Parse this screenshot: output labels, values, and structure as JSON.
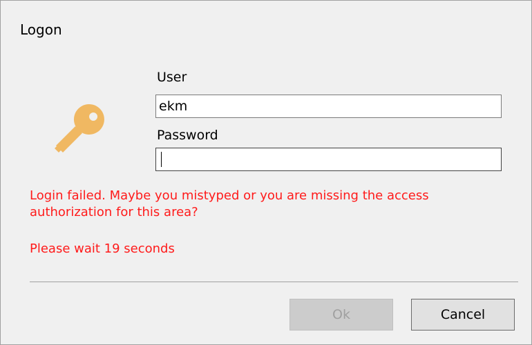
{
  "window": {
    "title": "Logon"
  },
  "form": {
    "user_label": "User",
    "user_value": "ekm",
    "password_label": "Password",
    "password_value": ""
  },
  "messages": {
    "error": "Login failed. Maybe you mistyped or you are missing the access authorization for this area?",
    "wait": "Please wait 19 seconds"
  },
  "buttons": {
    "ok_label": "Ok",
    "cancel_label": "Cancel"
  },
  "icons": {
    "key": "key-icon"
  },
  "colors": {
    "error_text": "#ff1a1a",
    "key_icon": "#f0b862"
  }
}
